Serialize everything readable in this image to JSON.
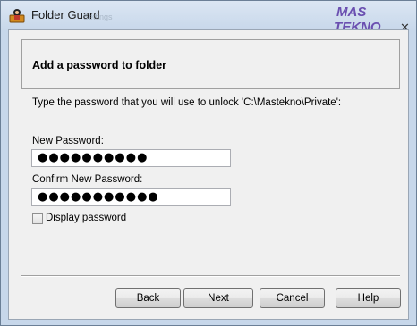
{
  "window": {
    "title": "Folder Guard",
    "ghost_text": "Settings"
  },
  "header": {
    "title": "Add a password to folder"
  },
  "instruction": "Type the password that you will use to unlock 'C:\\Mastekno\\Private':",
  "fields": {
    "new_password": {
      "label": "New Password:",
      "value": "●●●●●●●●●●"
    },
    "confirm_password": {
      "label": "Confirm New Password:",
      "value": "●●●●●●●●●●●"
    }
  },
  "checkbox": {
    "label": "Display password",
    "checked": false
  },
  "buttons": {
    "back": "Back",
    "next": "Next",
    "cancel": "Cancel",
    "help": "Help"
  },
  "watermark": {
    "line1": "MAS",
    "line2": "TEKNO"
  }
}
